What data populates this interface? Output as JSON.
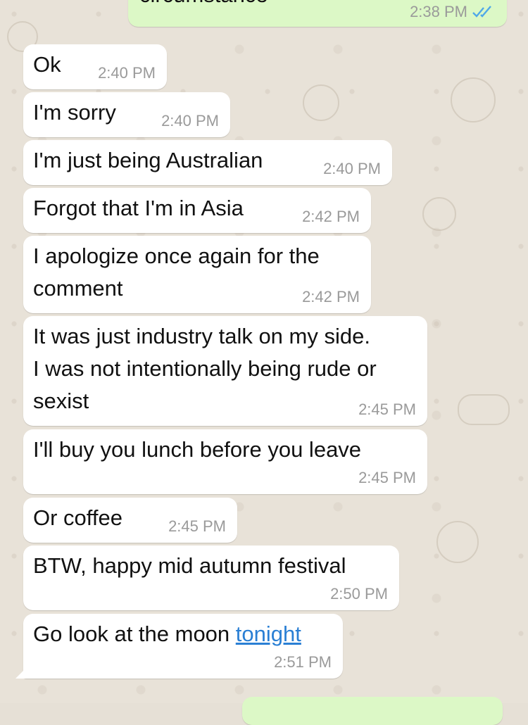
{
  "colors": {
    "incoming_bubble": "#ffffff",
    "outgoing_bubble": "#dcf8c6",
    "timestamp": "#9a9a9a",
    "read_ticks": "#4fa8e8",
    "link": "#2a7fd4"
  },
  "outgoing": [
    {
      "text": "circumstance",
      "time": "2:38 PM",
      "status_icon": "double-check-icon"
    }
  ],
  "messages": [
    {
      "text": "Ok",
      "time": "2:40 PM"
    },
    {
      "text": "I'm sorry",
      "time": "2:40 PM"
    },
    {
      "text": "I'm just being Australian",
      "time": "2:40 PM"
    },
    {
      "text": "Forgot that I'm in Asia",
      "time": "2:42 PM"
    },
    {
      "text": "I apologize once again for the\ncomment",
      "time": "2:42 PM"
    },
    {
      "text": "It was just industry talk on my side.\nI was not intentionally being rude or\nsexist",
      "time": "2:45 PM"
    },
    {
      "text": "I'll buy you lunch before you leave",
      "time": "2:45 PM"
    },
    {
      "text": "Or coffee",
      "time": "2:45 PM"
    },
    {
      "text": "BTW, happy mid autumn festival",
      "time": "2:50 PM"
    },
    {
      "text": "Go look at the moon ",
      "link": "tonight",
      "time": "2:51 PM"
    }
  ]
}
